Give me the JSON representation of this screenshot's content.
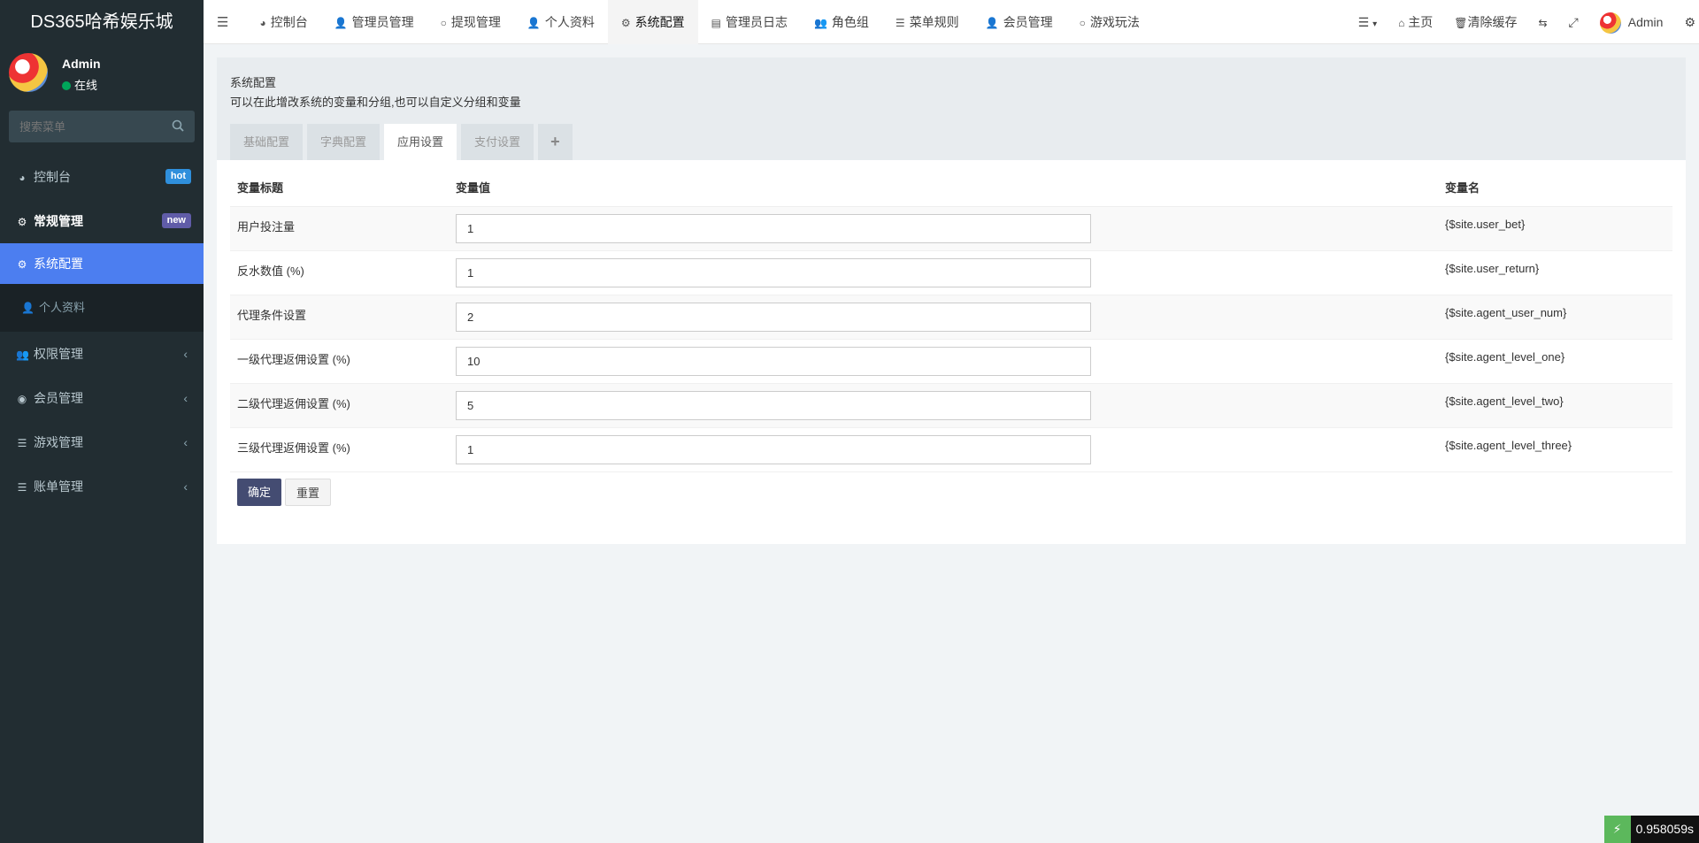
{
  "sidebar": {
    "logo": "DS365哈希娱乐城",
    "user_name": "Admin",
    "user_status": "在线",
    "search_placeholder": "搜索菜单",
    "items": [
      {
        "label": "控制台",
        "badge": "hot"
      },
      {
        "label": "常规管理",
        "badge": "new"
      },
      {
        "label": "系统配置"
      },
      {
        "label": "个人资料"
      },
      {
        "label": "权限管理"
      },
      {
        "label": "会员管理"
      },
      {
        "label": "游戏管理"
      },
      {
        "label": "账单管理"
      }
    ]
  },
  "topnav": {
    "tabs": [
      "控制台",
      "管理员管理",
      "提现管理",
      "个人资料",
      "系统配置",
      "管理员日志",
      "角色组",
      "菜单规则",
      "会员管理",
      "游戏玩法"
    ],
    "home": "主页",
    "clear_cache": "清除缓存",
    "admin": "Admin"
  },
  "content": {
    "title": "系统配置",
    "description": "可以在此增改系统的变量和分组,也可以自定义分组和变量",
    "tabs": [
      "基础配置",
      "字典配置",
      "应用设置",
      "支付设置",
      "+"
    ],
    "active_tab": "应用设置",
    "table": {
      "headers": [
        "变量标题",
        "变量值",
        "变量名"
      ],
      "rows": [
        {
          "title": "用户投注量",
          "value": "1",
          "name": "{$site.user_bet}"
        },
        {
          "title": "反水数值 (%)",
          "value": "1",
          "name": "{$site.user_return}"
        },
        {
          "title": "代理条件设置",
          "value": "2",
          "name": "{$site.agent_user_num}"
        },
        {
          "title": "一级代理返佣设置 (%)",
          "value": "10",
          "name": "{$site.agent_level_one}"
        },
        {
          "title": "二级代理返佣设置 (%)",
          "value": "5",
          "name": "{$site.agent_level_two}"
        },
        {
          "title": "三级代理返佣设置 (%)",
          "value": "1",
          "name": "{$site.agent_level_three}"
        }
      ]
    },
    "confirm_label": "确定",
    "reset_label": "重置"
  },
  "timer": "0.958059s",
  "colors": {
    "sidebar_bg": "#222d32",
    "active_menu": "#4c7ef0",
    "primary_button": "#444c72"
  }
}
